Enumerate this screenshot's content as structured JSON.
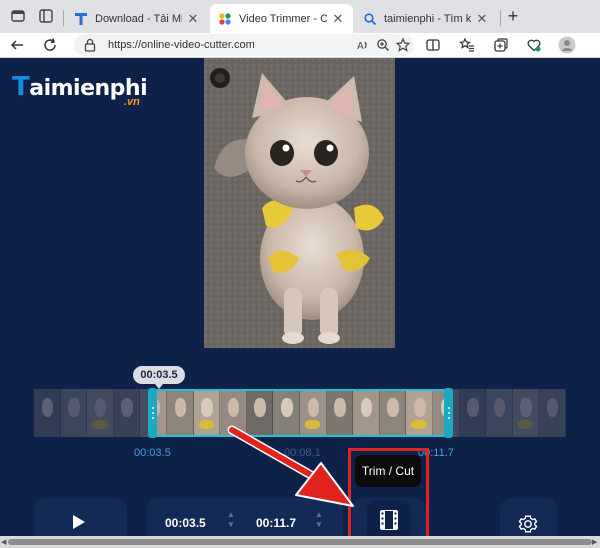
{
  "browser": {
    "tabs": [
      {
        "title": "Download - Tải Miễn Phí",
        "favicon": "taimienphi-t-icon",
        "active": false
      },
      {
        "title": "Video Trimmer - Cut Video",
        "favicon": "video-cutter-icon",
        "active": true
      },
      {
        "title": "taimienphi - Tìm kiếm",
        "favicon": "search-icon",
        "active": false
      }
    ],
    "address": {
      "url": "https://online-video-cutter.com"
    }
  },
  "logo": {
    "text": "Taimienphi",
    "suffix": ".vn"
  },
  "timeline": {
    "current_badge": "00:03.5",
    "start_label": "00:03.5",
    "middle_label": "00:08.1",
    "end_label": "00:11.7"
  },
  "controls": {
    "start_time": "00:03.5",
    "end_time": "00:11.7",
    "trim_tooltip": "Trim / Cut"
  },
  "colors": {
    "page_bg": "#0d2149",
    "selection": "#22c2d6",
    "highlight": "#e0231e",
    "label": "#4aa0d8"
  }
}
